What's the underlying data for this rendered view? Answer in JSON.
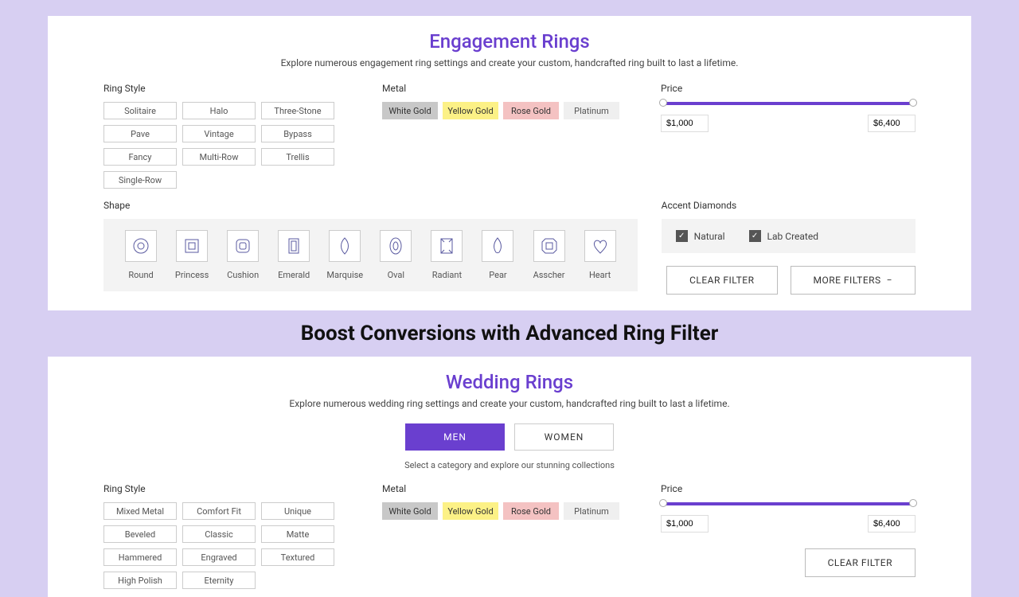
{
  "engagement": {
    "title": "Engagement Rings",
    "subtitle": "Explore numerous engagement ring settings and create your custom, handcrafted ring built to last a lifetime.",
    "ring_style_label": "Ring Style",
    "styles": [
      "Solitaire",
      "Halo",
      "Three-Stone",
      "Pave",
      "Vintage",
      "Bypass",
      "Fancy",
      "Multi-Row",
      "Trellis",
      "Single-Row"
    ],
    "metal_label": "Metal",
    "metals": [
      "White Gold",
      "Yellow Gold",
      "Rose Gold",
      "Platinum"
    ],
    "price_label": "Price",
    "price_min": "$1,000",
    "price_max": "$6,400",
    "shape_label": "Shape",
    "shapes": [
      "Round",
      "Princess",
      "Cushion",
      "Emerald",
      "Marquise",
      "Oval",
      "Radiant",
      "Pear",
      "Asscher",
      "Heart"
    ],
    "accent_label": "Accent Diamonds",
    "accent_natural": "Natural",
    "accent_lab": "Lab Created",
    "clear_filter": "CLEAR FILTER",
    "more_filters": "MORE FILTERS"
  },
  "caption": "Boost Conversions with Advanced Ring Filter",
  "wedding": {
    "title": "Wedding Rings",
    "subtitle": "Explore numerous wedding ring settings and create your custom, handcrafted ring built to last a lifetime.",
    "gender_men": "MEN",
    "gender_women": "WOMEN",
    "category_note": "Select a category and explore our stunning collections",
    "ring_style_label": "Ring Style",
    "styles": [
      "Mixed Metal",
      "Comfort Fit",
      "Unique",
      "Beveled",
      "Classic",
      "Matte",
      "Hammered",
      "Engraved",
      "Textured",
      "High Polish",
      "Eternity"
    ],
    "metal_label": "Metal",
    "metals": [
      "White Gold",
      "Yellow Gold",
      "Rose Gold",
      "Platinum"
    ],
    "price_label": "Price",
    "price_min": "$1,000",
    "price_max": "$6,400",
    "clear_filter": "CLEAR FILTER"
  }
}
